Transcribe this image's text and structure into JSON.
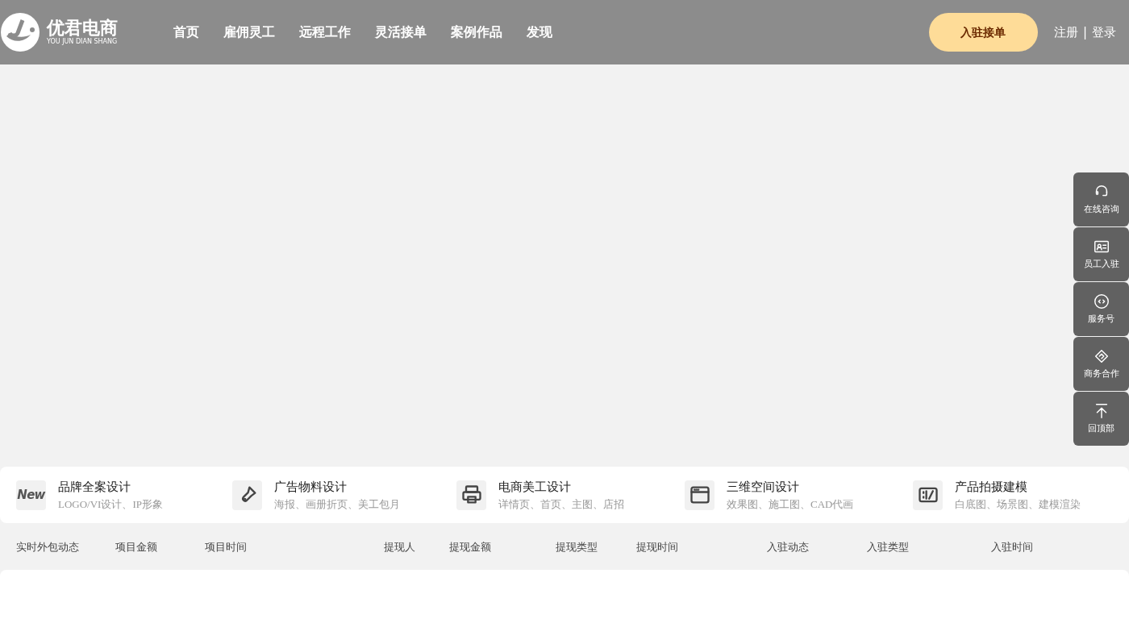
{
  "header": {
    "logo": {
      "name": "优君电商",
      "subtitle": "YOU JUN DIAN SHANG"
    },
    "nav": [
      {
        "label": "首页"
      },
      {
        "label": "雇佣灵工"
      },
      {
        "label": "远程工作"
      },
      {
        "label": "灵活接单"
      },
      {
        "label": "案例作品"
      },
      {
        "label": "发现"
      }
    ],
    "cta": "入驻接单",
    "register": "注册",
    "separator": "|",
    "login": "登录"
  },
  "categories": [
    {
      "title": "品牌全案设计",
      "subtitle": "LOGO/VI设计、IP形象",
      "icon_text": "New"
    },
    {
      "title": "广告物料设计",
      "subtitle": "海报、画册折页、美工包月"
    },
    {
      "title": "电商美工设计",
      "subtitle": "详情页、首页、主图、店招"
    },
    {
      "title": "三维空间设计",
      "subtitle": "效果图、施工图、CAD代画"
    },
    {
      "title": "产品拍摄建模",
      "subtitle": "白底图、场景图、建模渲染"
    }
  ],
  "feed_columns": [
    "实时外包动态",
    "项目金额",
    "项目时间",
    "提现人",
    "提现金额",
    "提现类型",
    "提现时间",
    "入驻动态",
    "入驻类型",
    "入驻时间"
  ],
  "side_tools": [
    {
      "label": "在线咨询"
    },
    {
      "label": "员工入驻"
    },
    {
      "label": "服务号"
    },
    {
      "label": "商务合作"
    },
    {
      "label": "回顶部"
    }
  ]
}
